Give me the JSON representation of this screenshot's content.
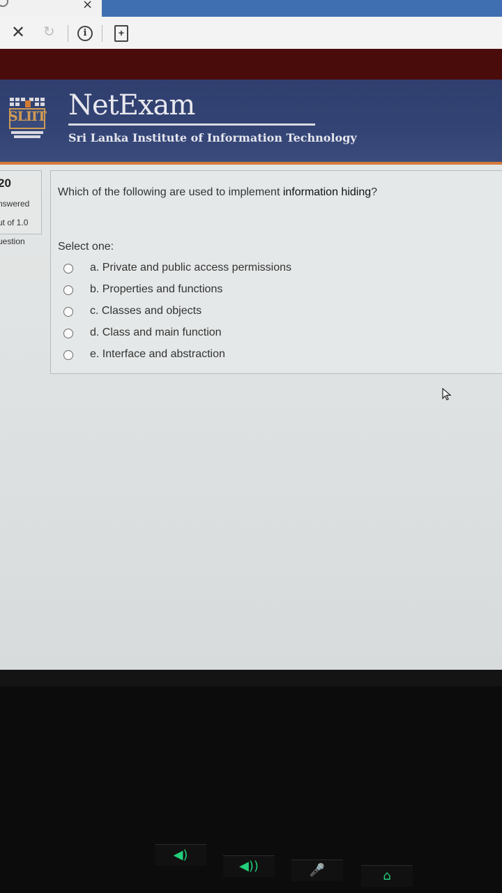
{
  "browser": {
    "tab_close": "×",
    "stop_icon": "close-icon",
    "reload_icon": "reload-icon",
    "info_icon": "info-icon",
    "page_icon": "page-icon",
    "stop_glyph": "✕",
    "reload_glyph": "↻",
    "info_glyph": "i",
    "page_glyph": "+"
  },
  "header": {
    "logo_text": "SLIIT",
    "title": "NetExam",
    "subtitle": "Sri Lanka Institute of Information Technology",
    "accent_color": "#d6793a",
    "bg_color": "#334474"
  },
  "question_info": {
    "number": "20",
    "status": "nswered",
    "marks": "ut of 1.0",
    "flag": "uestion"
  },
  "question": {
    "text_before": "Which of the following are used to implement ",
    "text_bold": "information hiding",
    "text_after": "?",
    "prompt": "Select one:",
    "options": [
      "a. Private and public access permissions",
      "b. Properties and functions",
      "c. Classes and objects",
      "d. Class and main function",
      "e. Interface and abstraction"
    ]
  },
  "keyboard": {
    "keys": [
      "◀)",
      "◀))",
      "🎤",
      "⌂"
    ]
  }
}
